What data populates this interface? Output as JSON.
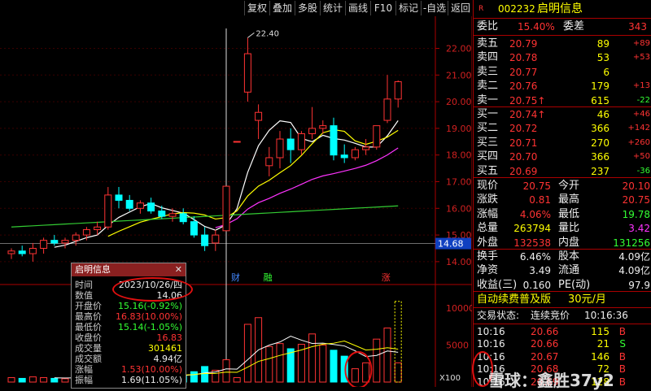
{
  "toolbar": [
    "复权",
    "叠加",
    "多股",
    "统计",
    "画线",
    "F10",
    "标记",
    "-自选",
    "返回"
  ],
  "stock": {
    "badge": "R",
    "code": "002232",
    "name": "启明信息"
  },
  "weibi": {
    "label": "委比",
    "value": "15.40%",
    "label2": "委差",
    "value2": "343"
  },
  "sells": [
    {
      "label": "卖五",
      "price": "20.79",
      "vol": "89",
      "chg": "+89"
    },
    {
      "label": "卖四",
      "price": "20.78",
      "vol": "53",
      "chg": "+53"
    },
    {
      "label": "卖三",
      "price": "20.77",
      "vol": "6",
      "chg": ""
    },
    {
      "label": "卖二",
      "price": "20.76",
      "vol": "179",
      "chg": "+13"
    },
    {
      "label": "卖一",
      "price": "20.75↑",
      "vol": "615",
      "chg": "-22"
    }
  ],
  "buys": [
    {
      "label": "买一",
      "price": "20.74↑",
      "vol": "46",
      "chg": "+46"
    },
    {
      "label": "买二",
      "price": "20.72",
      "vol": "366",
      "chg": "+142"
    },
    {
      "label": "买三",
      "price": "20.71",
      "vol": "270",
      "chg": "+260"
    },
    {
      "label": "买四",
      "price": "20.70",
      "vol": "366",
      "chg": "+50"
    },
    {
      "label": "买五",
      "price": "20.69",
      "vol": "237",
      "chg": "-36"
    }
  ],
  "quote": [
    {
      "l1": "现价",
      "v1": "20.75",
      "l2": "今开",
      "v2": "20.10"
    },
    {
      "l1": "涨跌",
      "v1": "0.81",
      "l2": "最高",
      "v2": "20.75"
    },
    {
      "l1": "涨幅",
      "v1": "4.06%",
      "l2": "最低",
      "v2": "19.78"
    },
    {
      "l1": "总量",
      "v1": "263794",
      "l2": "量比",
      "v2": "3.42"
    },
    {
      "l1": "外盘",
      "v1": "132538",
      "l2": "内盘",
      "v2": "131256"
    }
  ],
  "fin": [
    {
      "l1": "换手",
      "v1": "6.46%",
      "l2": "股本",
      "v2": "4.09亿"
    },
    {
      "l1": "净资",
      "v1": "3.49",
      "l2": "流通",
      "v2": "4.09亿"
    },
    {
      "l1": "收益(三)",
      "v1": "0.160",
      "l2": "PE(动)",
      "v2": "97.9"
    }
  ],
  "ad": {
    "text": "自动续费普及版",
    "price": "30元/月"
  },
  "trade_status": {
    "label": "交易状态:",
    "value": "连续竞价",
    "time": "10:16:36"
  },
  "ticks": [
    {
      "t": "10:16",
      "p": "20.66",
      "v": "115",
      "d": "B"
    },
    {
      "t": "10:16",
      "p": "20.66",
      "v": "21",
      "d": "S"
    },
    {
      "t": "10:16",
      "p": "20.67",
      "v": "146",
      "d": "B"
    },
    {
      "t": "10:16",
      "p": "20.68",
      "v": "72",
      "d": "B"
    },
    {
      "t": "10:16",
      "p": "20.69",
      "v": "128",
      "d": "B"
    }
  ],
  "tip": {
    "title": "启明信息",
    "rows": [
      {
        "l": "时间",
        "v": "2023/10/26/四"
      },
      {
        "l": "数值",
        "v": "14.06"
      },
      {
        "l": "开盘价",
        "v": "15.16(-0.92%)"
      },
      {
        "l": "最高价",
        "v": "16.83(10.00%)"
      },
      {
        "l": "最低价",
        "v": "15.14(-1.05%)"
      },
      {
        "l": "收盘价",
        "v": "16.83"
      },
      {
        "l": "成交量",
        "v": "301461"
      },
      {
        "l": "成交额",
        "v": "4.94亿"
      },
      {
        "l": "涨幅",
        "v": "1.53(10.00%)"
      },
      {
        "l": "振幅",
        "v": "1.69(11.05%)"
      }
    ]
  },
  "chart_labels": {
    "price_ticks": [
      "22.00",
      "21.00",
      "20.00",
      "19.00",
      "18.00",
      "17.00",
      "16.00",
      "15.00",
      "14.00"
    ],
    "current_price": "14.68",
    "high_label": "22.40",
    "vol_ticks": [
      "10000",
      "5000"
    ],
    "vol_unit": "X100",
    "events": [
      "财",
      "融",
      "涨"
    ]
  },
  "watermark": "雪球：鑫胜37y2",
  "chart_data": {
    "type": "candlestick",
    "ylim": [
      13.6,
      22.9
    ],
    "candles": [
      [
        14.3,
        14.5,
        14.1,
        14.4
      ],
      [
        14.4,
        14.6,
        14.2,
        14.3
      ],
      [
        14.3,
        14.7,
        14.0,
        14.5
      ],
      [
        14.5,
        14.9,
        14.3,
        14.8
      ],
      [
        14.8,
        15.0,
        14.6,
        14.7
      ],
      [
        14.7,
        14.9,
        14.5,
        14.8
      ],
      [
        14.8,
        15.1,
        14.6,
        15.0
      ],
      [
        15.0,
        15.3,
        14.8,
        15.2
      ],
      [
        15.2,
        15.5,
        15.0,
        15.3
      ],
      [
        15.3,
        16.8,
        15.2,
        16.5
      ],
      [
        16.5,
        16.8,
        16.0,
        16.3
      ],
      [
        16.3,
        16.5,
        15.9,
        16.0
      ],
      [
        16.0,
        16.3,
        15.8,
        16.2
      ],
      [
        16.2,
        16.4,
        15.8,
        15.9
      ],
      [
        15.9,
        16.1,
        15.6,
        15.7
      ],
      [
        15.7,
        16.0,
        15.5,
        15.8
      ],
      [
        15.8,
        16.0,
        15.4,
        15.5
      ],
      [
        15.5,
        15.7,
        14.9,
        15.0
      ],
      [
        15.0,
        15.3,
        14.4,
        14.6
      ],
      [
        14.7,
        15.2,
        14.4,
        15.0
      ],
      [
        15.16,
        16.83,
        15.14,
        16.83
      ],
      [
        18.51,
        18.51,
        18.51,
        18.51
      ],
      [
        20.36,
        22.4,
        20.0,
        21.8
      ],
      [
        19.3,
        19.9,
        18.6,
        19.6
      ],
      [
        17.6,
        18.3,
        17.2,
        17.9
      ],
      [
        17.9,
        18.9,
        17.5,
        18.6
      ],
      [
        18.6,
        19.0,
        17.7,
        18.2
      ],
      [
        18.2,
        18.9,
        18.0,
        18.8
      ],
      [
        18.8,
        19.8,
        18.6,
        19.0
      ],
      [
        19.0,
        19.3,
        18.8,
        19.1
      ],
      [
        19.1,
        19.4,
        17.8,
        18.0
      ],
      [
        18.0,
        18.4,
        17.7,
        17.9
      ],
      [
        17.9,
        18.3,
        17.8,
        18.2
      ],
      [
        18.2,
        18.6,
        18.0,
        18.3
      ],
      [
        18.3,
        19.1,
        18.2,
        19.1
      ],
      [
        19.3,
        21.0,
        19.2,
        20.1
      ],
      [
        20.1,
        20.8,
        19.78,
        20.75
      ]
    ],
    "volume": [
      600,
      500,
      700,
      600,
      500,
      450,
      600,
      700,
      800,
      1500,
      1200,
      900,
      800,
      900,
      1000,
      900,
      800,
      1400,
      2100,
      1600,
      3014,
      600,
      7800,
      8700,
      4800,
      5200,
      4500,
      5100,
      6500,
      5000,
      4300,
      3500,
      1800,
      2600,
      5800,
      7300,
      2600
    ]
  }
}
